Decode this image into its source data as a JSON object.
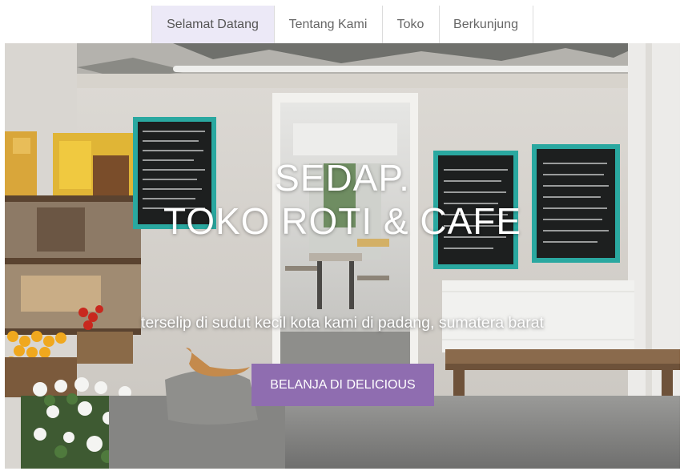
{
  "nav": {
    "items": [
      {
        "label": "Selamat Datang",
        "active": true
      },
      {
        "label": "Tentang Kami",
        "active": false
      },
      {
        "label": "Toko",
        "active": false
      },
      {
        "label": "Berkunjung",
        "active": false
      }
    ]
  },
  "hero": {
    "title_line1": "SEDAP.",
    "title_line2": "TOKO ROTI & CAFE",
    "subtitle": "terselip di sudut kecil  kota kami di padang, sumatera barat",
    "cta_label": "BELANJA DI DELICIOUS"
  },
  "colors": {
    "accent": "#8f6db0",
    "nav_active_bg": "#ece9f7",
    "nav_text": "#666666",
    "chalkboard_frame": "#2aa8a0"
  }
}
